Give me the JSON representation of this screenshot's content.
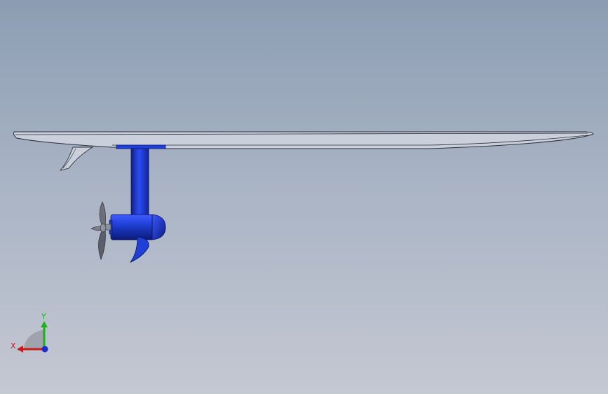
{
  "window": {
    "background_top": "#8c9db3",
    "background_bottom": "#c4c8d2"
  },
  "model": {
    "board_color": "#c9d0dc",
    "board_outline": "#2b2f3a",
    "fin_color": "#c9d0dc",
    "motor_color": "#1f3fd6",
    "motor_highlight": "#5a78ff",
    "motor_shadow": "#0f1f8a",
    "propeller_color": "#5a5f6b",
    "propeller_hub_color": "#8e939e"
  },
  "triad": {
    "x_label": "X",
    "y_label": "Y",
    "x_color": "#cc1b1b",
    "y_color": "#1bb31b",
    "z_color": "#1b2bcc",
    "plane_color": "#9aa0aa"
  }
}
